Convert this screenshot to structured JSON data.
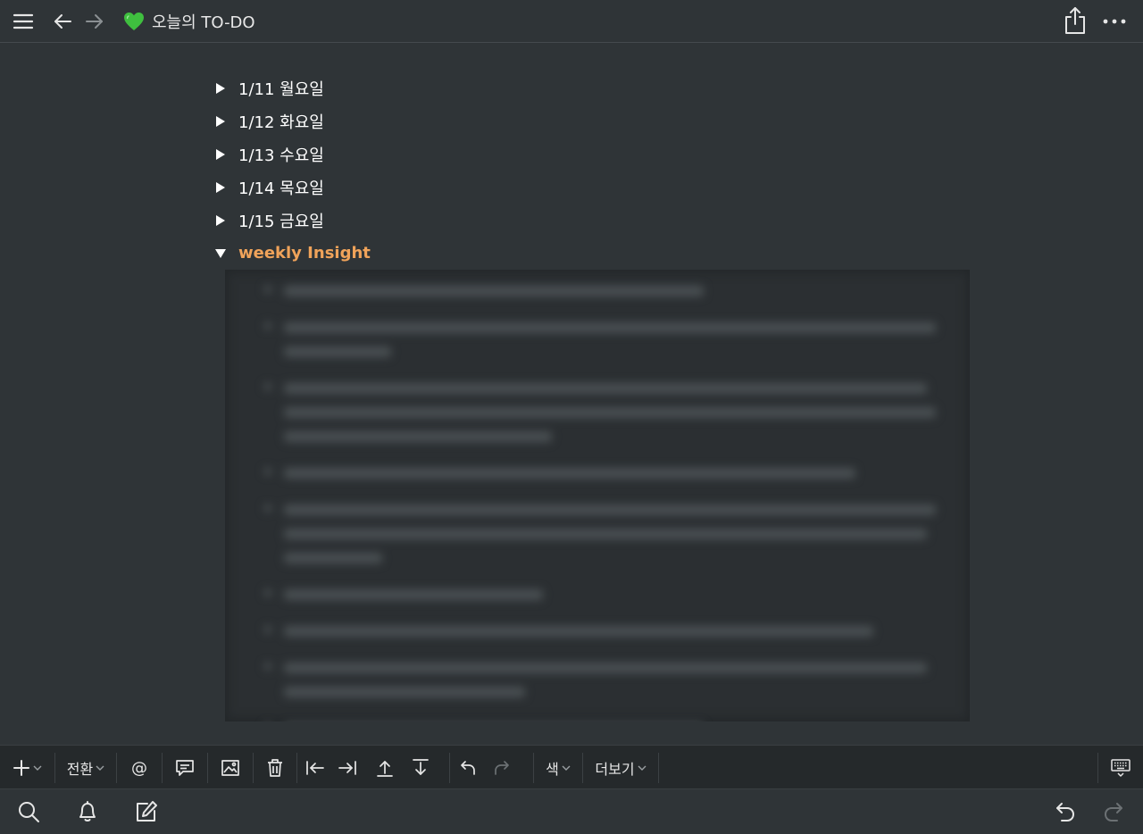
{
  "header": {
    "title": "오늘의 TO-DO",
    "page_icon": "green-heart-icon"
  },
  "toggles": [
    {
      "label": "1/11 월요일",
      "open": false
    },
    {
      "label": "1/12 화요일",
      "open": false
    },
    {
      "label": "1/13 수요일",
      "open": false
    },
    {
      "label": "1/14 목요일",
      "open": false
    },
    {
      "label": "1/15 금요일",
      "open": false
    },
    {
      "label": "weekly Insight",
      "open": true
    }
  ],
  "toolbar": {
    "convert_label": "전환",
    "mention_label": "@",
    "color_label": "색",
    "more_label": "더보기"
  },
  "colors": {
    "background": "#2f3437",
    "accent": "#f0a35a",
    "heart": "#3fbf3f"
  }
}
